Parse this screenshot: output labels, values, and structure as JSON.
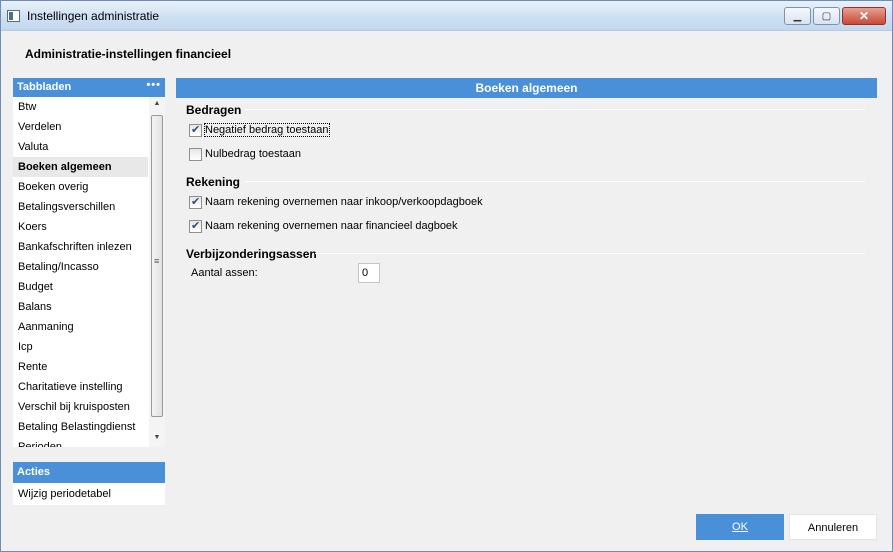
{
  "window": {
    "title": "Instellingen administratie"
  },
  "header": {
    "title": "Administratie-instellingen financieel"
  },
  "tabs_panel": {
    "title": "Tabbladen",
    "more": "•••",
    "items": [
      {
        "label": "Btw",
        "active": false
      },
      {
        "label": "Verdelen",
        "active": false
      },
      {
        "label": "Valuta",
        "active": false
      },
      {
        "label": "Boeken algemeen",
        "active": true
      },
      {
        "label": "Boeken overig",
        "active": false
      },
      {
        "label": "Betalingsverschillen",
        "active": false
      },
      {
        "label": "Koers",
        "active": false
      },
      {
        "label": "Bankafschriften inlezen",
        "active": false
      },
      {
        "label": "Betaling/Incasso",
        "active": false
      },
      {
        "label": "Budget",
        "active": false
      },
      {
        "label": "Balans",
        "active": false
      },
      {
        "label": "Aanmaning",
        "active": false
      },
      {
        "label": "Icp",
        "active": false
      },
      {
        "label": "Rente",
        "active": false
      },
      {
        "label": "Charitatieve instelling",
        "active": false
      },
      {
        "label": "Verschil bij kruisposten",
        "active": false
      },
      {
        "label": "Betaling Belastingdienst",
        "active": false
      },
      {
        "label": "Perioden",
        "active": false
      }
    ]
  },
  "actions_panel": {
    "title": "Acties",
    "items": [
      {
        "label": "Wijzig periodetabel"
      }
    ]
  },
  "main": {
    "title": "Boeken algemeen",
    "groups": {
      "bedragen": {
        "title": "Bedragen",
        "checkboxes": [
          {
            "label": "Negatief bedrag toestaan",
            "checked": true
          },
          {
            "label": "Nulbedrag toestaan",
            "checked": false
          }
        ]
      },
      "rekening": {
        "title": "Rekening",
        "checkboxes": [
          {
            "label": "Naam rekening overnemen naar inkoop/verkoopdagboek",
            "checked": true
          },
          {
            "label": "Naam rekening overnemen naar financieel dagboek",
            "checked": true
          }
        ]
      },
      "verbijzondering": {
        "title": "Verbijzonderingsassen",
        "field_label": "Aantal assen:",
        "field_value": "0"
      }
    }
  },
  "footer": {
    "ok_label": "OK",
    "cancel_label": "Annuleren"
  },
  "colors": {
    "accent": "#4a90d9",
    "window_bg": "#f0f0f0"
  }
}
